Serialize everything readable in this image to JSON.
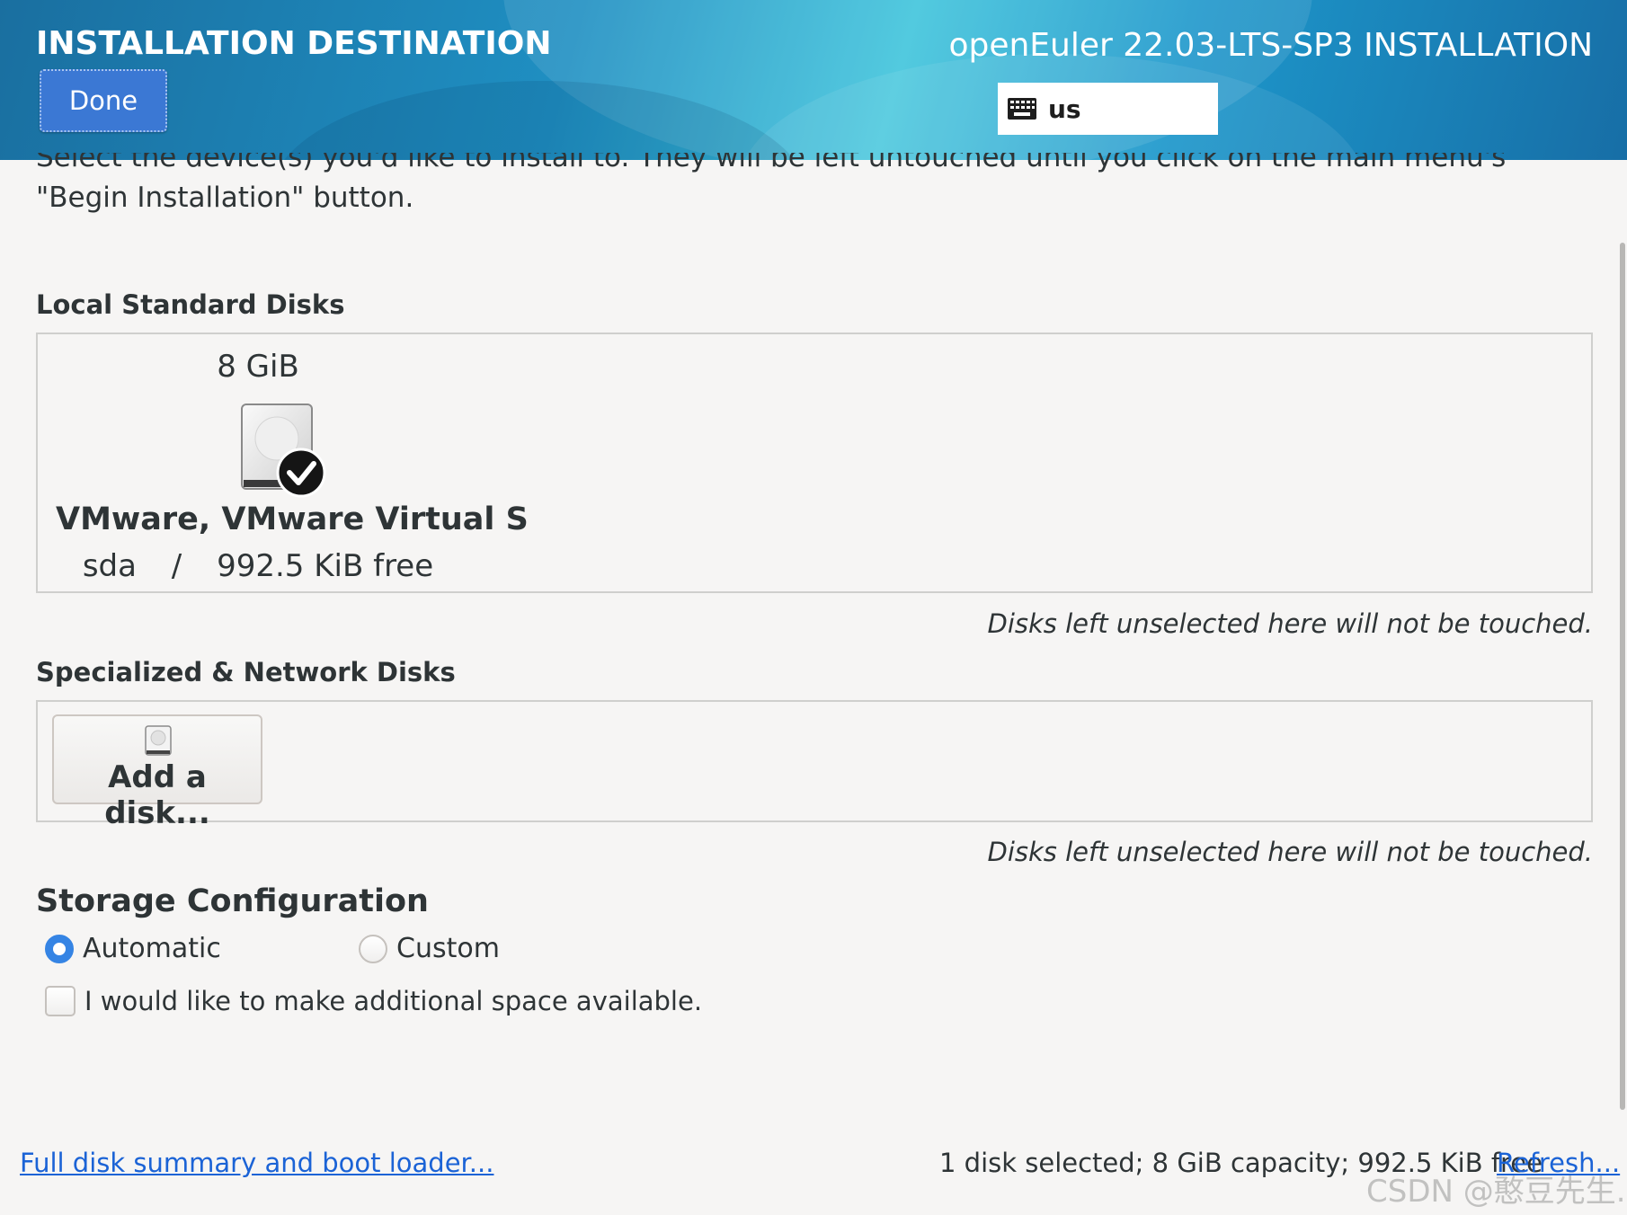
{
  "header": {
    "page_title": "INSTALLATION DESTINATION",
    "done_label": "Done",
    "product_title": "openEuler 22.03-LTS-SP3 INSTALLATION",
    "keyboard_layout": "us",
    "keyboard_icon": "keyboard-icon"
  },
  "intro": {
    "line1": "Select the device(s) you'd like to install to.  They will be left untouched until you click on the main menu's",
    "line2": "\"Begin Installation\" button."
  },
  "local_disks": {
    "heading": "Local Standard Disks",
    "disks": [
      {
        "size": "8 GiB",
        "name": "VMware, VMware Virtual S",
        "device": "sda",
        "separator": "/",
        "free": "992.5 KiB free",
        "selected": true,
        "icon": "hard-disk-icon"
      }
    ],
    "note": "Disks left unselected here will not be touched."
  },
  "network_disks": {
    "heading": "Specialized & Network Disks",
    "add_disk_label": "Add a disk...",
    "note": "Disks left unselected here will not be touched."
  },
  "storage": {
    "heading": "Storage Configuration",
    "options": [
      {
        "label": "Automatic",
        "selected": true
      },
      {
        "label": "Custom",
        "selected": false
      }
    ],
    "extra_space_label": "I would like to make additional space available.",
    "extra_space_checked": false
  },
  "footer": {
    "summary_link": "Full disk summary and boot loader...",
    "status": "1 disk selected; 8 GiB capacity; 992.5 KiB free",
    "refresh_link": "Refresh..."
  },
  "watermark": "CSDN @憨豆先生.",
  "colors": {
    "accent": "#3584e4",
    "link": "#1b63d6",
    "header_dark": "#1a6fa0",
    "header_light": "#3fc4dc"
  }
}
